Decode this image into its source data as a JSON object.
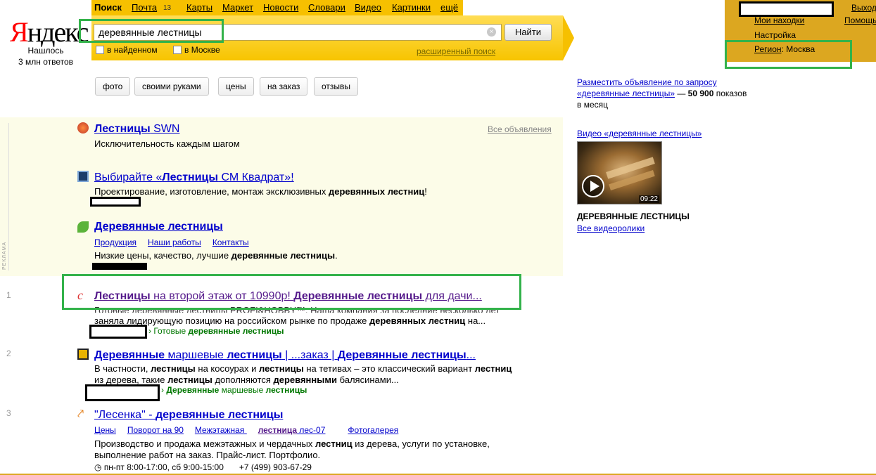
{
  "logo": {
    "letter_red": "Я",
    "rest": "ндекс",
    "found_line1": "Нашлось",
    "found_line2": "3 млн ответов"
  },
  "topnav": {
    "items": [
      "Поиск",
      "Почта",
      "Карты",
      "Маркет",
      "Новости",
      "Словари",
      "Видео",
      "Картинки",
      "ещё"
    ],
    "mail_count": "13"
  },
  "search": {
    "query": "деревянные лестницы",
    "button": "Найти",
    "clear": "×",
    "in_found": "в найденном",
    "in_city": "в Москве",
    "advanced": "расширенный поиск"
  },
  "chips": [
    "фото",
    "своими руками",
    "цены",
    "на заказ",
    "отзывы"
  ],
  "rightpanel": {
    "finds": "Мои находки",
    "settings": "Настройка",
    "region_label": "Регион",
    "region_value": ": Москва",
    "logout": "Выход",
    "help": "Помощь"
  },
  "ads": {
    "all": "Все объявления",
    "label": "РЕКЛАМА",
    "items": [
      {
        "title_b": "Лестницы",
        "title_rest": " SWN",
        "text": "Исключительность каждым шагом"
      },
      {
        "title_pre": "Выбирайте «",
        "title_b": "Лестницы",
        "title_rest": " СМ Квадрат»!",
        "text_pre": "Проектирование, изготовление, монтаж эксклюзивных ",
        "text_b": "деревянных лестниц",
        "text_post": "!"
      },
      {
        "title_b": "Деревянные лестницы",
        "links": [
          "Продукция",
          "Наши работы",
          "Контакты"
        ],
        "text_pre": "Низкие цены, качество, лучшие ",
        "text_b": "деревянные лестницы",
        "text_post": "."
      }
    ]
  },
  "results": [
    {
      "num": "1",
      "t1b": "Лестницы",
      "t1": " на второй этаж от 10990р! ",
      "t2b": "Деревянные лестницы",
      "t2": " для дачи...",
      "line1": "Готовые деревянные лестницы PROFI&HOBBY™. Наша компания за последние несколько лет",
      "line2_pre": "заняла лидирующую позицию на российском рынке по продаже ",
      "line2_b": "деревянных лестниц",
      "line2_post": " на...",
      "green_pre": "› Готовые ",
      "green_b": "деревянные лестницы"
    },
    {
      "num": "2",
      "t1b": "Деревянные",
      "t1": " маршевые ",
      "t2b": "лестницы",
      "t2": " | ...заказ | ",
      "t3b": "Деревянные лестницы",
      "t3": "...",
      "line1_a": "В частности, ",
      "line1_b": "лестницы",
      "line1_c": " на косоурах и ",
      "line1_d": "лестницы",
      "line1_e": " на тетивах – это классический вариант ",
      "line1_f": "лестниц",
      "line2_a": "из дерева, такие ",
      "line2_b": "лестницы",
      "line2_c": " дополняются ",
      "line2_d": "деревянными",
      "line2_e": " балясинами...",
      "green_pre": "› ",
      "green_b": "Деревянные",
      "green_mid": " маршевые ",
      "green_b2": "лестницы"
    },
    {
      "num": "3",
      "t1": "\"Лесенка\" - ",
      "t1b": "деревянные лестницы",
      "links": [
        "Цены",
        "Поворот на 90",
        "Межэтажная ",
        "лестница",
        " лес-07",
        "Фотогалерея"
      ],
      "line1_a": "Производство и продажа межэтажных и чердачных ",
      "line1_b": "лестниц",
      "line1_c": " из дерева, услуги по установке,",
      "line2": "выполнение работ на заказ. Прайс-лист. Портфолио.",
      "hours": "пн-пт 8:00-17:00, сб 9:00-15:00",
      "phone": "+7 (499) 903-67-29"
    }
  ],
  "right": {
    "ad_line1": "Разместить объявление по запросу",
    "ad_query": "«деревянные лестницы»",
    "ad_dash": " — ",
    "ad_count": "50 900",
    "ad_shows": " показов",
    "ad_month": "в месяц",
    "video_head": "Видео «деревянные лестницы»",
    "duration": "09:22",
    "video_title": "ДЕРЕВЯННЫЕ ЛЕСТНИЦЫ",
    "all_videos": "Все видеоролики"
  },
  "colors": {
    "brand_yellow": "#f6c000",
    "panel_gold": "#dca720",
    "highlight_green": "#33b24a",
    "link": "#0000cc",
    "visited": "#551a8b",
    "url_green": "#007700"
  }
}
